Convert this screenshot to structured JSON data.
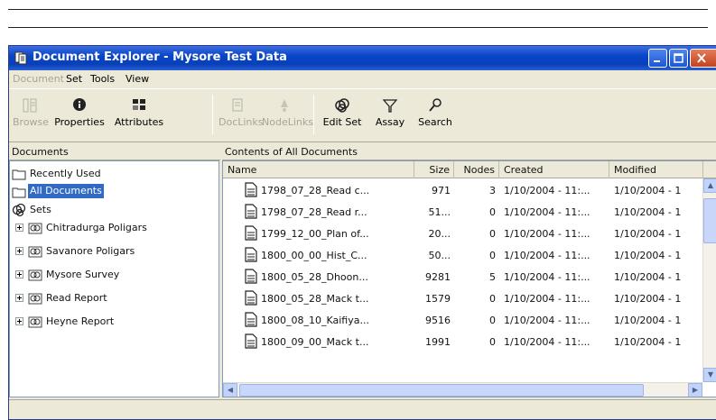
{
  "window": {
    "title": "Document Explorer - Mysore Test Data"
  },
  "menu": [
    {
      "label": "Document",
      "disabled": true
    },
    {
      "label": "Set",
      "disabled": false
    },
    {
      "label": "Tools",
      "disabled": false
    },
    {
      "label": "View",
      "disabled": false
    }
  ],
  "toolbar": {
    "browse": "Browse",
    "properties": "Properties",
    "attributes": "Attributes",
    "doclinks": "DocLinks",
    "nodelinks": "NodeLinks",
    "edit_set": "Edit Set",
    "assay": "Assay",
    "search": "Search"
  },
  "left_pane": {
    "header": "Documents",
    "items": [
      {
        "label": "Recently Used",
        "icon": "folder-icon"
      },
      {
        "label": "All Documents",
        "icon": "folder-icon",
        "selected": true
      },
      {
        "label": "Sets",
        "icon": "sets-icon"
      },
      {
        "label": "Chitradurga Poligars",
        "icon": "set-icon"
      },
      {
        "label": "Savanore Poligars",
        "icon": "set-icon"
      },
      {
        "label": "Mysore Survey",
        "icon": "set-icon"
      },
      {
        "label": "Read Report",
        "icon": "set-icon"
      },
      {
        "label": "Heyne Report",
        "icon": "set-icon"
      }
    ]
  },
  "right_pane": {
    "header": "Contents of All Documents",
    "columns": [
      "Name",
      "Size",
      "Nodes",
      "Created",
      "Modified"
    ],
    "rows": [
      {
        "name": "1798_07_28_Read c...",
        "size": "971",
        "nodes": "3",
        "created": "1/10/2004 - 11:...",
        "modified": "1/10/2004 - 1"
      },
      {
        "name": "1798_07_28_Read r...",
        "size": "51...",
        "nodes": "0",
        "created": "1/10/2004 - 11:...",
        "modified": "1/10/2004 - 1"
      },
      {
        "name": "1799_12_00_Plan of...",
        "size": "20...",
        "nodes": "0",
        "created": "1/10/2004 - 11:...",
        "modified": "1/10/2004 - 1"
      },
      {
        "name": "1800_00_00_Hist_C...",
        "size": "50...",
        "nodes": "0",
        "created": "1/10/2004 - 11:...",
        "modified": "1/10/2004 - 1"
      },
      {
        "name": "1800_05_28_Dhoon...",
        "size": "9281",
        "nodes": "5",
        "created": "1/10/2004 - 11:...",
        "modified": "1/10/2004 - 1"
      },
      {
        "name": "1800_05_28_Mack t...",
        "size": "1579",
        "nodes": "0",
        "created": "1/10/2004 - 11:...",
        "modified": "1/10/2004 - 1"
      },
      {
        "name": "1800_08_10_Kaifiya...",
        "size": "9516",
        "nodes": "0",
        "created": "1/10/2004 - 11:...",
        "modified": "1/10/2004 - 1"
      },
      {
        "name": "1800_09_00_Mack t...",
        "size": "1991",
        "nodes": "0",
        "created": "1/10/2004 - 11:...",
        "modified": "1/10/2004 - 1"
      }
    ]
  },
  "colors": {
    "titlebar": "#0a45c8",
    "face": "#ece9d8",
    "selection": "#316ac5"
  }
}
